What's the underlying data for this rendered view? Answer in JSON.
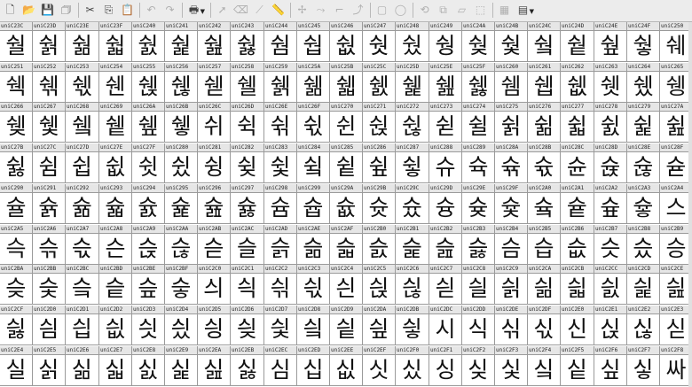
{
  "toolbar": {
    "buttons": [
      {
        "name": "new-file",
        "icon": "new-file-icon",
        "glyph": "🗋"
      },
      {
        "name": "open",
        "icon": "open-folder-icon",
        "glyph": "📂"
      },
      {
        "name": "save",
        "icon": "save-icon",
        "glyph": "💾"
      },
      {
        "name": "save-all",
        "icon": "save-all-icon",
        "glyph": "🗇"
      },
      {
        "sep": true
      },
      {
        "name": "cut",
        "icon": "scissors-icon",
        "glyph": "✂"
      },
      {
        "name": "copy",
        "icon": "copy-icon",
        "glyph": "⎘"
      },
      {
        "name": "paste",
        "icon": "paste-icon",
        "glyph": "📋"
      },
      {
        "sep": true
      },
      {
        "name": "undo",
        "icon": "undo-icon",
        "glyph": "↶",
        "disabled": true
      },
      {
        "name": "redo",
        "icon": "redo-icon",
        "glyph": "↷",
        "disabled": true
      },
      {
        "sep": true
      },
      {
        "name": "print",
        "icon": "print-icon",
        "glyph": "🖶",
        "drop": true
      },
      {
        "sep": true
      },
      {
        "name": "pointer",
        "icon": "pointer-icon",
        "glyph": "➚",
        "disabled": true
      },
      {
        "name": "eraser",
        "icon": "eraser-icon",
        "glyph": "⌫",
        "disabled": true
      },
      {
        "name": "knife",
        "icon": "knife-icon",
        "glyph": "⟋",
        "disabled": true
      },
      {
        "name": "ruler",
        "icon": "ruler-icon",
        "glyph": "📏",
        "disabled": true
      },
      {
        "sep": true
      },
      {
        "name": "add-point",
        "icon": "add-point-icon",
        "glyph": "✢",
        "disabled": true
      },
      {
        "name": "add-curve",
        "icon": "add-curve-icon",
        "glyph": "⤳",
        "disabled": true
      },
      {
        "name": "add-corner",
        "icon": "add-corner-icon",
        "glyph": "⌐",
        "disabled": true
      },
      {
        "name": "add-tangent",
        "icon": "add-tangent-icon",
        "glyph": "⤴",
        "disabled": true
      },
      {
        "sep": true
      },
      {
        "name": "rectangle",
        "icon": "rectangle-icon",
        "glyph": "▢",
        "disabled": true
      },
      {
        "name": "ellipse",
        "icon": "ellipse-icon",
        "glyph": "◯",
        "disabled": true
      },
      {
        "sep": true
      },
      {
        "name": "rotate",
        "icon": "rotate-icon",
        "glyph": "⟲",
        "disabled": true
      },
      {
        "name": "scale",
        "icon": "scale-icon",
        "glyph": "⧉",
        "disabled": true
      },
      {
        "name": "skew",
        "icon": "skew-icon",
        "glyph": "▱",
        "disabled": true
      },
      {
        "name": "flip",
        "icon": "flip-icon",
        "glyph": "⬚",
        "disabled": true
      },
      {
        "sep": true
      },
      {
        "name": "grid-view",
        "icon": "grid-view-icon",
        "glyph": "▦",
        "disabled": true
      },
      {
        "name": "display-options",
        "icon": "display-options-icon",
        "glyph": "▤",
        "drop": true
      }
    ]
  },
  "grid": {
    "rows": [
      [
        {
          "c": "uniC23C",
          "g": "숼"
        },
        {
          "c": "uniC23D",
          "g": "숽"
        },
        {
          "c": "uniC23E",
          "g": "숾"
        },
        {
          "c": "uniC23F",
          "g": "숿"
        },
        {
          "c": "uniC240",
          "g": "쉀"
        },
        {
          "c": "uniC241",
          "g": "쉁"
        },
        {
          "c": "uniC242",
          "g": "쉂"
        },
        {
          "c": "uniC243",
          "g": "쉃"
        },
        {
          "c": "uniC244",
          "g": "쉄"
        },
        {
          "c": "uniC245",
          "g": "쉅"
        },
        {
          "c": "uniC246",
          "g": "쉆"
        },
        {
          "c": "uniC247",
          "g": "쉇"
        },
        {
          "c": "uniC248",
          "g": "쉈"
        },
        {
          "c": "uniC249",
          "g": "쉉"
        },
        {
          "c": "uniC24A",
          "g": "쉊"
        },
        {
          "c": "uniC24B",
          "g": "쉋"
        },
        {
          "c": "uniC24C",
          "g": "쉌"
        },
        {
          "c": "uniC24D",
          "g": "쉍"
        },
        {
          "c": "uniC24E",
          "g": "쉎"
        },
        {
          "c": "uniC24F",
          "g": "쉏"
        },
        {
          "c": "uniC250",
          "g": "쉐"
        }
      ],
      [
        {
          "c": "uniC251",
          "g": "쉑"
        },
        {
          "c": "uniC252",
          "g": "쉒"
        },
        {
          "c": "uniC253",
          "g": "쉓"
        },
        {
          "c": "uniC254",
          "g": "쉔"
        },
        {
          "c": "uniC255",
          "g": "쉕"
        },
        {
          "c": "uniC256",
          "g": "쉖"
        },
        {
          "c": "uniC257",
          "g": "쉗"
        },
        {
          "c": "uniC258",
          "g": "쉘"
        },
        {
          "c": "uniC259",
          "g": "쉙"
        },
        {
          "c": "uniC25A",
          "g": "쉚"
        },
        {
          "c": "uniC25B",
          "g": "쉛"
        },
        {
          "c": "uniC25C",
          "g": "쉜"
        },
        {
          "c": "uniC25D",
          "g": "쉝"
        },
        {
          "c": "uniC25E",
          "g": "쉞"
        },
        {
          "c": "uniC25F",
          "g": "쉟"
        },
        {
          "c": "uniC260",
          "g": "쉠"
        },
        {
          "c": "uniC261",
          "g": "쉡"
        },
        {
          "c": "uniC262",
          "g": "쉢"
        },
        {
          "c": "uniC263",
          "g": "쉣"
        },
        {
          "c": "uniC264",
          "g": "쉤"
        },
        {
          "c": "uniC265",
          "g": "쉥"
        }
      ],
      [
        {
          "c": "uniC266",
          "g": "쉦"
        },
        {
          "c": "uniC267",
          "g": "쉧"
        },
        {
          "c": "uniC268",
          "g": "쉨"
        },
        {
          "c": "uniC269",
          "g": "쉩"
        },
        {
          "c": "uniC26A",
          "g": "쉪"
        },
        {
          "c": "uniC26B",
          "g": "쉫"
        },
        {
          "c": "uniC26C",
          "g": "쉬"
        },
        {
          "c": "uniC26D",
          "g": "쉭"
        },
        {
          "c": "uniC26E",
          "g": "쉮"
        },
        {
          "c": "uniC26F",
          "g": "쉯"
        },
        {
          "c": "uniC270",
          "g": "쉰"
        },
        {
          "c": "uniC271",
          "g": "쉱"
        },
        {
          "c": "uniC272",
          "g": "쉲"
        },
        {
          "c": "uniC273",
          "g": "쉳"
        },
        {
          "c": "uniC274",
          "g": "쉴"
        },
        {
          "c": "uniC275",
          "g": "쉵"
        },
        {
          "c": "uniC276",
          "g": "쉶"
        },
        {
          "c": "uniC277",
          "g": "쉷"
        },
        {
          "c": "uniC278",
          "g": "쉸"
        },
        {
          "c": "uniC279",
          "g": "쉹"
        },
        {
          "c": "uniC27A",
          "g": "쉺"
        }
      ],
      [
        {
          "c": "uniC27B",
          "g": "쉻"
        },
        {
          "c": "uniC27C",
          "g": "쉼"
        },
        {
          "c": "uniC27D",
          "g": "쉽"
        },
        {
          "c": "uniC27E",
          "g": "쉾"
        },
        {
          "c": "uniC27F",
          "g": "쉿"
        },
        {
          "c": "uniC280",
          "g": "슀"
        },
        {
          "c": "uniC281",
          "g": "슁"
        },
        {
          "c": "uniC282",
          "g": "슂"
        },
        {
          "c": "uniC283",
          "g": "슃"
        },
        {
          "c": "uniC284",
          "g": "슄"
        },
        {
          "c": "uniC285",
          "g": "슅"
        },
        {
          "c": "uniC286",
          "g": "슆"
        },
        {
          "c": "uniC287",
          "g": "슇"
        },
        {
          "c": "uniC288",
          "g": "슈"
        },
        {
          "c": "uniC289",
          "g": "슉"
        },
        {
          "c": "uniC28A",
          "g": "슊"
        },
        {
          "c": "uniC28B",
          "g": "슋"
        },
        {
          "c": "uniC28C",
          "g": "슌"
        },
        {
          "c": "uniC28D",
          "g": "슍"
        },
        {
          "c": "uniC28E",
          "g": "슎"
        },
        {
          "c": "uniC28F",
          "g": "슏"
        }
      ],
      [
        {
          "c": "uniC290",
          "g": "슐"
        },
        {
          "c": "uniC291",
          "g": "슑"
        },
        {
          "c": "uniC292",
          "g": "슒"
        },
        {
          "c": "uniC293",
          "g": "슓"
        },
        {
          "c": "uniC294",
          "g": "슔"
        },
        {
          "c": "uniC295",
          "g": "슕"
        },
        {
          "c": "uniC296",
          "g": "슖"
        },
        {
          "c": "uniC297",
          "g": "슗"
        },
        {
          "c": "uniC298",
          "g": "슘"
        },
        {
          "c": "uniC299",
          "g": "슙"
        },
        {
          "c": "uniC29A",
          "g": "슚"
        },
        {
          "c": "uniC29B",
          "g": "슛"
        },
        {
          "c": "uniC29C",
          "g": "슜"
        },
        {
          "c": "uniC29D",
          "g": "슝"
        },
        {
          "c": "uniC29E",
          "g": "슞"
        },
        {
          "c": "uniC29F",
          "g": "슟"
        },
        {
          "c": "uniC2A0",
          "g": "슠"
        },
        {
          "c": "uniC2A1",
          "g": "슡"
        },
        {
          "c": "uniC2A2",
          "g": "슢"
        },
        {
          "c": "uniC2A3",
          "g": "슣"
        },
        {
          "c": "uniC2A4",
          "g": "스"
        }
      ],
      [
        {
          "c": "uniC2A5",
          "g": "슥"
        },
        {
          "c": "uniC2A6",
          "g": "슦"
        },
        {
          "c": "uniC2A7",
          "g": "슧"
        },
        {
          "c": "uniC2A8",
          "g": "슨"
        },
        {
          "c": "uniC2A9",
          "g": "슩"
        },
        {
          "c": "uniC2AA",
          "g": "슪"
        },
        {
          "c": "uniC2AB",
          "g": "슫"
        },
        {
          "c": "uniC2AC",
          "g": "슬"
        },
        {
          "c": "uniC2AD",
          "g": "슭"
        },
        {
          "c": "uniC2AE",
          "g": "슮"
        },
        {
          "c": "uniC2AF",
          "g": "슯"
        },
        {
          "c": "uniC2B0",
          "g": "슰"
        },
        {
          "c": "uniC2B1",
          "g": "슱"
        },
        {
          "c": "uniC2B2",
          "g": "슲"
        },
        {
          "c": "uniC2B3",
          "g": "슳"
        },
        {
          "c": "uniC2B4",
          "g": "슴"
        },
        {
          "c": "uniC2B5",
          "g": "습"
        },
        {
          "c": "uniC2B6",
          "g": "슶"
        },
        {
          "c": "uniC2B7",
          "g": "슷"
        },
        {
          "c": "uniC2B8",
          "g": "슸"
        },
        {
          "c": "uniC2B9",
          "g": "승"
        }
      ],
      [
        {
          "c": "uniC2BA",
          "g": "슺"
        },
        {
          "c": "uniC2BB",
          "g": "슻"
        },
        {
          "c": "uniC2BC",
          "g": "슼"
        },
        {
          "c": "uniC2BD",
          "g": "슽"
        },
        {
          "c": "uniC2BE",
          "g": "슾"
        },
        {
          "c": "uniC2BF",
          "g": "슿"
        },
        {
          "c": "uniC2C0",
          "g": "싀"
        },
        {
          "c": "uniC2C1",
          "g": "싁"
        },
        {
          "c": "uniC2C2",
          "g": "싂"
        },
        {
          "c": "uniC2C3",
          "g": "싃"
        },
        {
          "c": "uniC2C4",
          "g": "싄"
        },
        {
          "c": "uniC2C5",
          "g": "싅"
        },
        {
          "c": "uniC2C6",
          "g": "싆"
        },
        {
          "c": "uniC2C7",
          "g": "싇"
        },
        {
          "c": "uniC2C8",
          "g": "싈"
        },
        {
          "c": "uniC2C9",
          "g": "싉"
        },
        {
          "c": "uniC2CA",
          "g": "싊"
        },
        {
          "c": "uniC2CB",
          "g": "싋"
        },
        {
          "c": "uniC2CC",
          "g": "싌"
        },
        {
          "c": "uniC2CD",
          "g": "싍"
        },
        {
          "c": "uniC2CE",
          "g": "싎"
        }
      ],
      [
        {
          "c": "uniC2CF",
          "g": "싏"
        },
        {
          "c": "uniC2D0",
          "g": "싐"
        },
        {
          "c": "uniC2D1",
          "g": "싑"
        },
        {
          "c": "uniC2D2",
          "g": "싒"
        },
        {
          "c": "uniC2D3",
          "g": "싓"
        },
        {
          "c": "uniC2D4",
          "g": "싔"
        },
        {
          "c": "uniC2D5",
          "g": "싕"
        },
        {
          "c": "uniC2D6",
          "g": "싖"
        },
        {
          "c": "uniC2D7",
          "g": "싗"
        },
        {
          "c": "uniC2D8",
          "g": "싘"
        },
        {
          "c": "uniC2D9",
          "g": "싙"
        },
        {
          "c": "uniC2DA",
          "g": "싚"
        },
        {
          "c": "uniC2DB",
          "g": "싛"
        },
        {
          "c": "uniC2DC",
          "g": "시"
        },
        {
          "c": "uniC2DD",
          "g": "식"
        },
        {
          "c": "uniC2DE",
          "g": "싞"
        },
        {
          "c": "uniC2DF",
          "g": "싟"
        },
        {
          "c": "uniC2E0",
          "g": "신"
        },
        {
          "c": "uniC2E1",
          "g": "싡"
        },
        {
          "c": "uniC2E2",
          "g": "싢"
        },
        {
          "c": "uniC2E3",
          "g": "싣"
        }
      ],
      [
        {
          "c": "uniC2E4",
          "g": "실"
        },
        {
          "c": "uniC2E5",
          "g": "싥"
        },
        {
          "c": "uniC2E6",
          "g": "싦"
        },
        {
          "c": "uniC2E7",
          "g": "싧"
        },
        {
          "c": "uniC2E8",
          "g": "싨"
        },
        {
          "c": "uniC2E9",
          "g": "싩"
        },
        {
          "c": "uniC2EA",
          "g": "싪"
        },
        {
          "c": "uniC2EB",
          "g": "싫"
        },
        {
          "c": "uniC2EC",
          "g": "심"
        },
        {
          "c": "uniC2ED",
          "g": "십"
        },
        {
          "c": "uniC2EE",
          "g": "싮"
        },
        {
          "c": "uniC2EF",
          "g": "싯"
        },
        {
          "c": "uniC2F0",
          "g": "싰"
        },
        {
          "c": "uniC2F1",
          "g": "싱"
        },
        {
          "c": "uniC2F2",
          "g": "싲"
        },
        {
          "c": "uniC2F3",
          "g": "싳"
        },
        {
          "c": "uniC2F4",
          "g": "싴"
        },
        {
          "c": "uniC2F5",
          "g": "싵"
        },
        {
          "c": "uniC2F6",
          "g": "싶"
        },
        {
          "c": "uniC2F7",
          "g": "싷"
        },
        {
          "c": "uniC2F8",
          "g": "싸"
        }
      ]
    ]
  }
}
